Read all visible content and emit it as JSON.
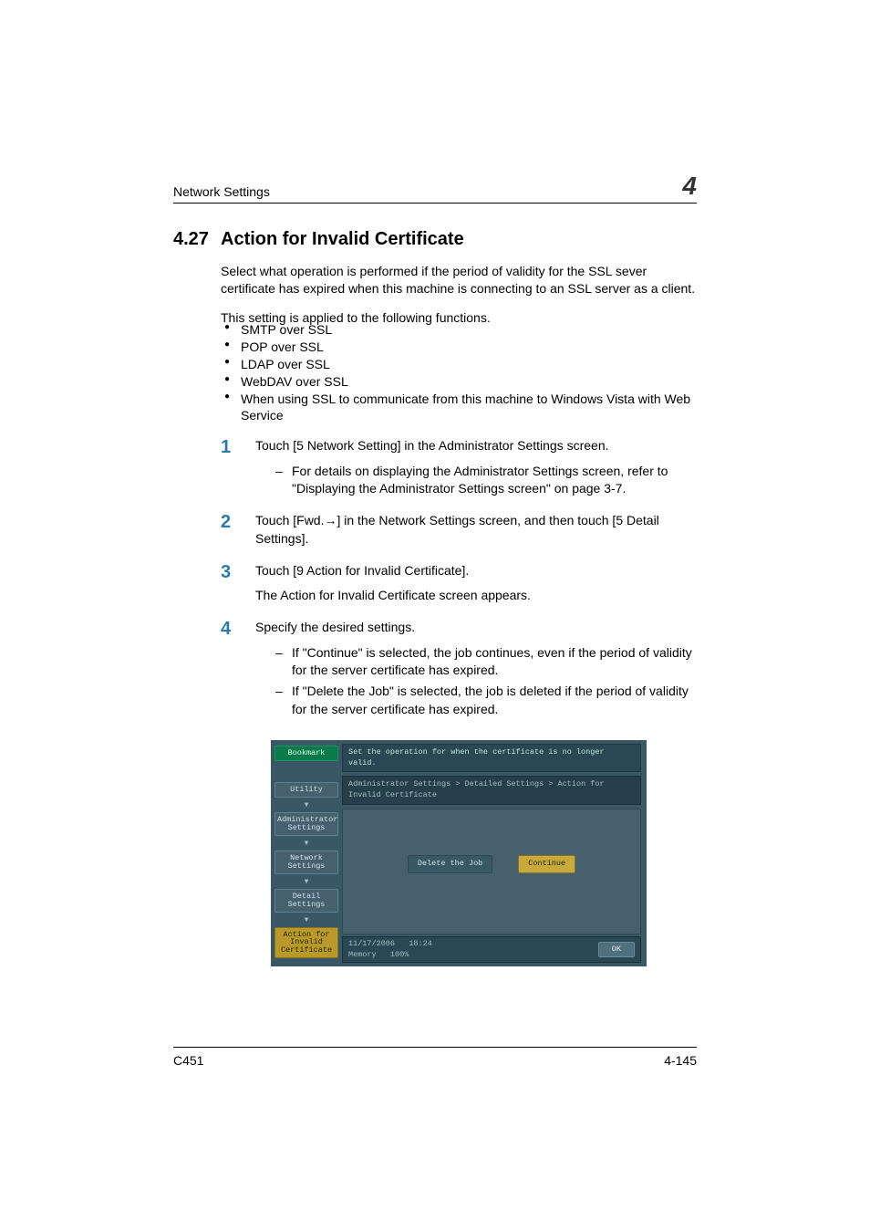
{
  "header": {
    "left": "Network Settings",
    "chapter": "4"
  },
  "section": {
    "number": "4.27",
    "title": "Action for Invalid Certificate"
  },
  "intro1": "Select what operation is performed if the period of validity for the SSL sever certificate has expired when this machine is connecting to an SSL server as a client.",
  "intro2": "This setting is applied to the following functions.",
  "bullets": [
    "SMTP over SSL",
    "POP over SSL",
    "LDAP over SSL",
    "WebDAV over SSL",
    "When using SSL to communicate from this machine to Windows Vista with Web Service"
  ],
  "steps": [
    {
      "n": "1",
      "text": "Touch [5 Network Setting] in the Administrator Settings screen.",
      "sub": [
        "For details on displaying the Administrator Settings screen, refer to \"Displaying the Administrator Settings screen\" on page 3-7."
      ]
    },
    {
      "n": "2",
      "text": "Touch [Fwd.→] in the Network Settings screen, and then touch [5 Detail Settings]."
    },
    {
      "n": "3",
      "text": "Touch [9 Action for Invalid Certificate].",
      "after": "The Action for Invalid Certificate screen appears."
    },
    {
      "n": "4",
      "text": "Specify the desired settings.",
      "sub": [
        "If \"Continue\" is selected, the job continues, even if the period of validity for the server certificate has expired.",
        "If \"Delete the Job\" is selected, the job is deleted if the period of validity for the server certificate has expired."
      ]
    }
  ],
  "device": {
    "topbar": "Set the operation for when the certificate is no longer valid.",
    "breadcrumb": "Administrator Settings > Detailed Settings > Action for Invalid Certificate",
    "left": {
      "bookmark": "Bookmark",
      "utility": "Utility",
      "admin": "Administrator\nSettings",
      "network": "Network\nSettings",
      "detail": "Detail\nSettings",
      "action": "Action for\nInvalid\nCertificate"
    },
    "options": {
      "delete": "Delete the Job",
      "continue": "Continue"
    },
    "status": {
      "date": "11/17/2006",
      "time": "18:24",
      "memlabel": "Memory",
      "mem": "100%",
      "ok": "OK"
    }
  },
  "footer": {
    "left": "C451",
    "right": "4-145"
  }
}
